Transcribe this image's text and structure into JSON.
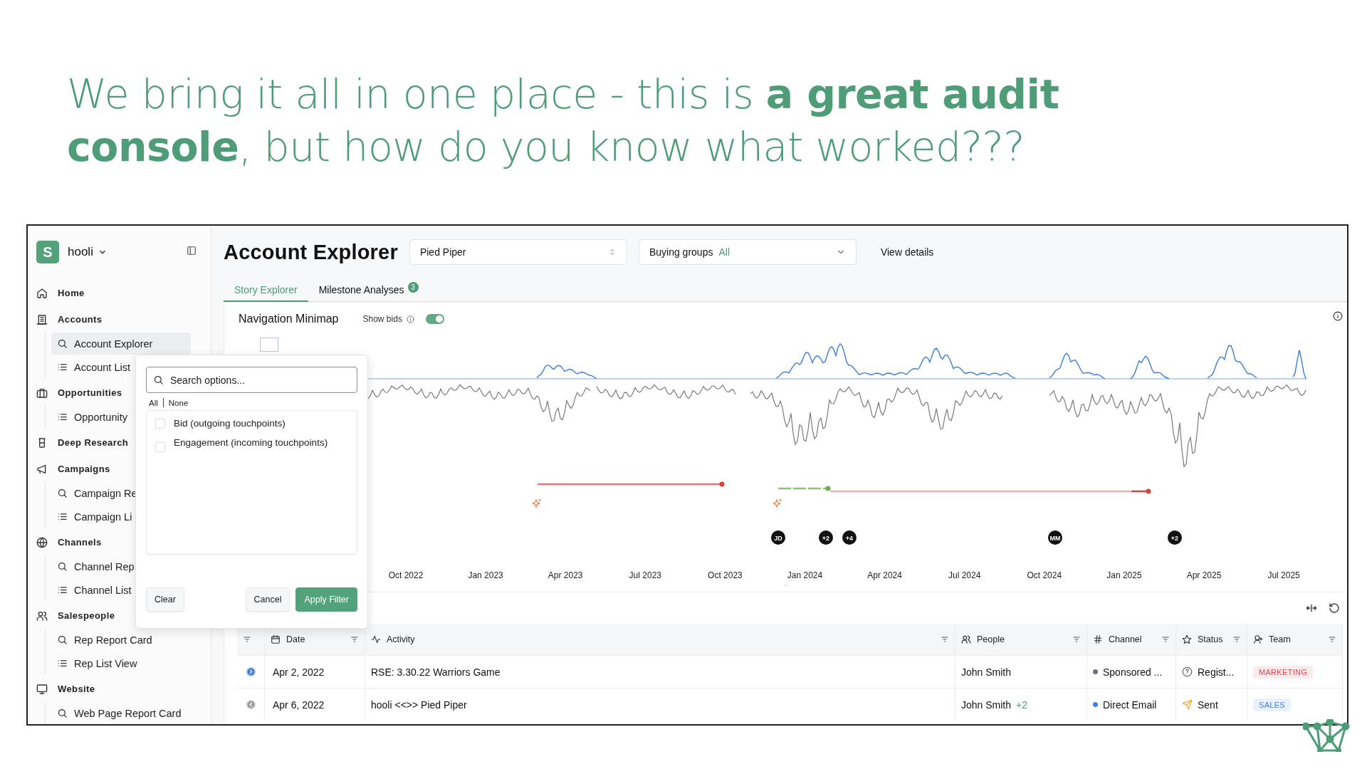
{
  "headline": "We bring it all in one place - this is **a great audit console**, but how do you know what worked???",
  "workspace": {
    "logo": "S",
    "name": "hooli"
  },
  "sidebar": {
    "sections": [
      {
        "label": "Home",
        "kind": "home"
      },
      {
        "label": "Accounts",
        "kind": "building",
        "children": [
          {
            "label": "Account Explorer",
            "kind": "search",
            "selected": true
          },
          {
            "label": "Account List",
            "kind": "list",
            "selected": false
          }
        ]
      },
      {
        "label": "Opportunities",
        "kind": "briefcase",
        "children": [
          {
            "label": "Opportunity",
            "kind": "list",
            "selected": false
          }
        ]
      },
      {
        "label": "Deep Research",
        "kind": "jar"
      },
      {
        "label": "Campaigns",
        "kind": "megaphone",
        "children": [
          {
            "label": "Campaign Re",
            "kind": "search",
            "selected": false
          },
          {
            "label": "Campaign Li",
            "kind": "list",
            "selected": false
          }
        ]
      },
      {
        "label": "Channels",
        "kind": "globe",
        "children": [
          {
            "label": "Channel Rep",
            "kind": "search",
            "selected": false
          },
          {
            "label": "Channel List",
            "kind": "list",
            "selected": false
          }
        ]
      },
      {
        "label": "Salespeople",
        "kind": "people",
        "children": [
          {
            "label": "Rep Report Card",
            "kind": "search",
            "selected": false
          },
          {
            "label": "Rep List View",
            "kind": "list",
            "selected": false
          }
        ]
      },
      {
        "label": "Website",
        "kind": "monitor",
        "children": [
          {
            "label": "Web Page Report Card",
            "kind": "search",
            "selected": false
          }
        ]
      }
    ]
  },
  "header": {
    "title": "Account Explorer",
    "account_select": {
      "value": "Pied Piper"
    },
    "buying_groups": {
      "label": "Buying groups",
      "value": "All"
    },
    "view_details": "View details"
  },
  "tabs": [
    {
      "label": "Story Explorer",
      "selected": true
    },
    {
      "label": "Milestone Analyses",
      "selected": false,
      "badge": "3"
    }
  ],
  "chart_panel": {
    "title": "Navigation Minimap",
    "show_bids": {
      "label": "Show bids",
      "on": true
    },
    "avatars": [
      "JD",
      "+2",
      "+4",
      "MM",
      "+2"
    ],
    "x_labels": [
      "Oct 2022",
      "Jan 2023",
      "Apr 2023",
      "Jul 2023",
      "Oct 2023",
      "Jan 2024",
      "Apr 2024",
      "Jul 2024",
      "Oct 2024",
      "Jan 2025",
      "Apr 2025",
      "Jul 2025"
    ]
  },
  "filter_popup": {
    "search": {
      "placeholder": "Search options..."
    },
    "select_all": "All",
    "select_none": "None",
    "options": [
      {
        "label": "Bid (outgoing touchpoints)",
        "checked": false
      },
      {
        "label": "Engagement (incoming touchpoints)",
        "checked": false
      }
    ],
    "buttons": [
      {
        "label": "Clear",
        "kind": "secondary"
      },
      {
        "label": "Cancel",
        "kind": "secondary"
      },
      {
        "label": "Apply Filter",
        "kind": "primary"
      }
    ]
  },
  "table": {
    "columns": [
      {
        "label": "Date",
        "kind": "calendar"
      },
      {
        "label": "Activity",
        "kind": "pulse"
      },
      {
        "label": "People",
        "kind": "people"
      },
      {
        "label": "Channel",
        "kind": "hash"
      },
      {
        "label": "Status",
        "kind": "star"
      },
      {
        "label": "Team",
        "kind": "person"
      }
    ],
    "rows": [
      {
        "kind": "outgoing",
        "date": "Apr 2, 2022",
        "activity": "RSE: 3.30.22 Warriors Game",
        "people": "John Smith",
        "channel": {
          "label": "Sponsored ...",
          "color": "#6b7280"
        },
        "status": {
          "label": "Regist...",
          "kind": "pending"
        },
        "team": {
          "label": "MARKETING",
          "color": "#e0454f"
        }
      },
      {
        "kind": "incoming",
        "date": "Apr 6, 2022",
        "activity": "hooli <<>> Pied Piper",
        "people": "John Smith",
        "people_extra": "+2",
        "channel": {
          "label": "Direct Email",
          "color": "#3b82f6"
        },
        "status": {
          "label": "Sent",
          "kind": "sent"
        },
        "team": {
          "label": "SALES",
          "color": "#3b82f6"
        }
      }
    ]
  }
}
